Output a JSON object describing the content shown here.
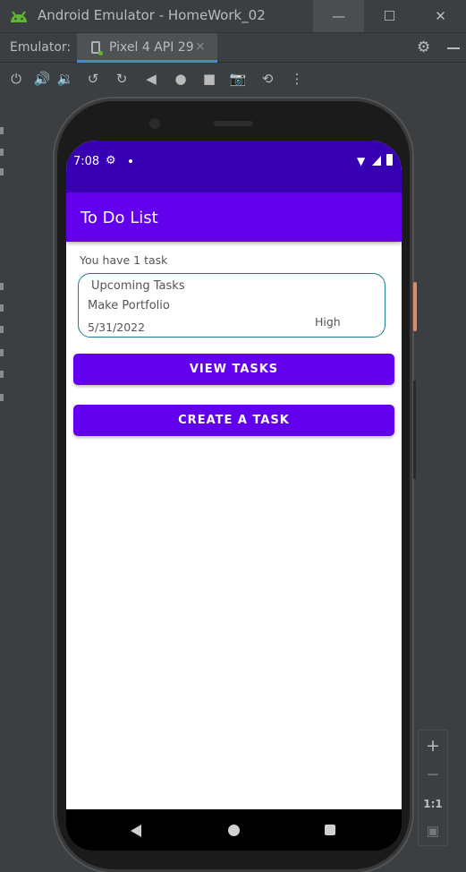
{
  "window": {
    "title": "Android Emulator - HomeWork_02",
    "minimize": "—",
    "maximize": "☐",
    "close": "✕"
  },
  "tabbar": {
    "label": "Emulator:",
    "device_tab": "Pixel 4 API 29",
    "close_glyph": "×",
    "settings_glyph": "⚙"
  },
  "toolbar": {
    "icons": [
      "power-icon",
      "volume-up-icon",
      "volume-down-icon",
      "rotate-left-icon",
      "rotate-right-icon",
      "back-icon",
      "home-icon",
      "overview-icon",
      "screenshot-icon",
      "snapshot-icon",
      "more-icon"
    ],
    "glyphs": [
      "⏻",
      "🔊",
      "🔉",
      "↺",
      "↻",
      "◀",
      "●",
      "■",
      "📷",
      "⟲",
      "⋮"
    ]
  },
  "status": {
    "time": "7:08",
    "settings_glyph": "⚙",
    "wifi_glyph": "▼"
  },
  "app": {
    "title": "To Do List",
    "task_count": "You have 1 task",
    "card": {
      "title": "Upcoming Tasks",
      "task_name": "Make Portfolio",
      "date": "5/31/2022",
      "priority": "High"
    },
    "view_button": "VIEW TASKS",
    "create_button": "CREATE A TASK",
    "accent": "#6200ee",
    "status_color": "#3700b3"
  },
  "zoom": {
    "plus": "+",
    "minus": "−",
    "one_to_one": "1:1",
    "fit_glyph": "▣"
  }
}
